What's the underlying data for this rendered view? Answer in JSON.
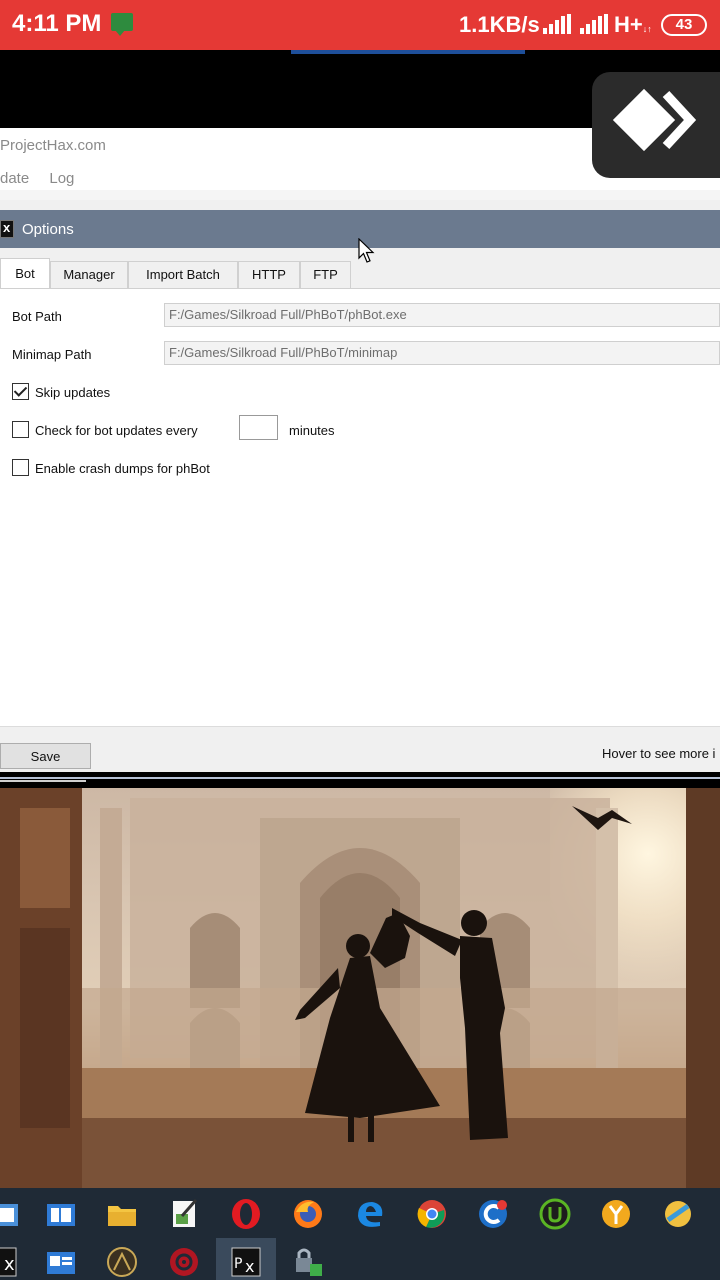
{
  "status_bar": {
    "time": "4:11 PM",
    "speed": "1.1KB/s",
    "network": "H+",
    "network_sub": "↓↑",
    "battery": "43",
    "icons": [
      "notification-icon",
      "signal-icon",
      "signal-icon",
      "battery-icon"
    ]
  },
  "main_window": {
    "site": "ProjectHax.com",
    "menu": [
      "date",
      "Log"
    ]
  },
  "options_dialog": {
    "title": "Options",
    "tabs": [
      {
        "label": "Bot",
        "active": true
      },
      {
        "label": "Manager",
        "active": false
      },
      {
        "label": "Import Batch",
        "active": false
      },
      {
        "label": "HTTP",
        "active": false
      },
      {
        "label": "FTP",
        "active": false
      }
    ],
    "fields": {
      "bot_path_label": "Bot Path",
      "bot_path_value": "F:/Games/Silkroad Full/PhBoT/phBot.exe",
      "minimap_path_label": "Minimap Path",
      "minimap_path_value": "F:/Games/Silkroad Full/PhBoT/minimap"
    },
    "checkboxes": {
      "skip_updates_label": "Skip updates",
      "skip_updates_checked": true,
      "check_updates_label": "Check for bot updates every",
      "check_updates_checked": false,
      "minutes_value": "",
      "minutes_label": "minutes",
      "crash_dumps_label": "Enable crash dumps for phBot",
      "crash_dumps_checked": false
    },
    "footer": {
      "save_label": "Save",
      "hover_hint": "Hover to see more i"
    }
  },
  "taskbar": {
    "row1": [
      "window-icon",
      "window-icon",
      "folder-icon",
      "notepad-icon",
      "opera-icon",
      "firefox-icon",
      "edge-icon",
      "chrome-icon",
      "ccleaner-icon",
      "utorrent-icon",
      "app-icon",
      "app-icon"
    ],
    "row2": [
      "phbot-icon",
      "contact-icon",
      "game-icon",
      "security-icon",
      "phbot-icon",
      "lock-icon"
    ]
  },
  "colors": {
    "status_bar": "#e53935",
    "dialog_title": "#6b7a8f",
    "taskbar": "#1f2a36"
  }
}
